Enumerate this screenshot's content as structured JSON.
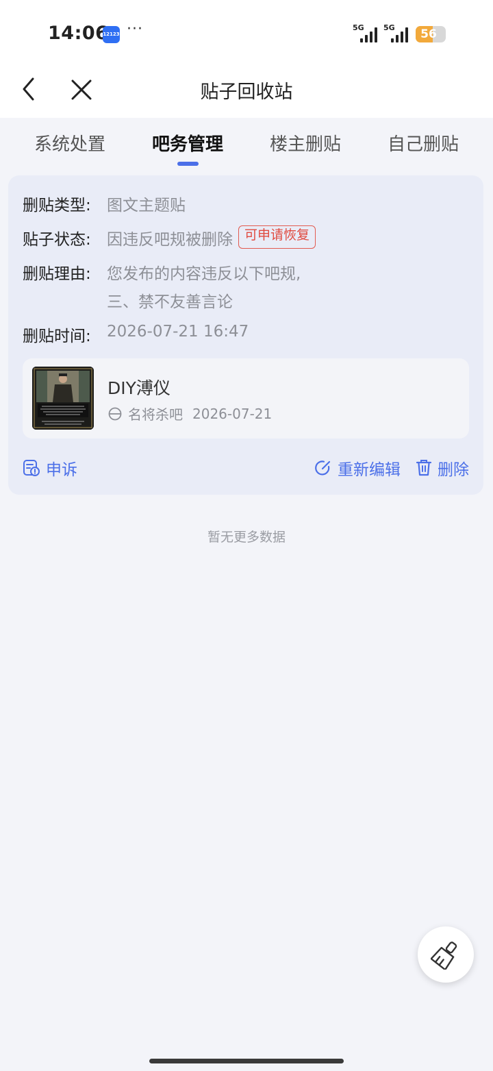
{
  "status_bar": {
    "time": "14:06",
    "app_icon_text": "12123",
    "more": "···",
    "signal1": "5G",
    "signal2": "5G",
    "battery_level": 56,
    "battery_text": "56"
  },
  "header": {
    "title": "贴子回收站",
    "back_icon": "chevron-left-icon",
    "close_icon": "close-icon"
  },
  "tabs": [
    {
      "label": "系统处置",
      "active": false
    },
    {
      "label": "吧务管理",
      "active": true
    },
    {
      "label": "楼主删贴",
      "active": false
    },
    {
      "label": "自己删贴",
      "active": false
    }
  ],
  "record": {
    "type_label": "删贴类型:",
    "type_value": "图文主题贴",
    "status_label": "贴子状态:",
    "status_value": "因违反吧规被删除",
    "status_badge": "可申请恢复",
    "reason_label": "删贴理由:",
    "reason_line1": "您发布的内容违反以下吧规,",
    "reason_line2": "三、禁不友善言论",
    "time_label": "删贴时间:",
    "time_value": "2026-07-21 16:47",
    "post": {
      "title": "DIY溥仪",
      "forum": "名将杀吧",
      "date": "2026-07-21"
    },
    "actions": {
      "appeal": "申诉",
      "reedit": "重新编辑",
      "delete": "删除"
    }
  },
  "footer": {
    "no_more": "暂无更多数据"
  },
  "colors": {
    "accent": "#4b6fe8",
    "badge": "#e04a3f",
    "battery": "#f2a93b"
  }
}
